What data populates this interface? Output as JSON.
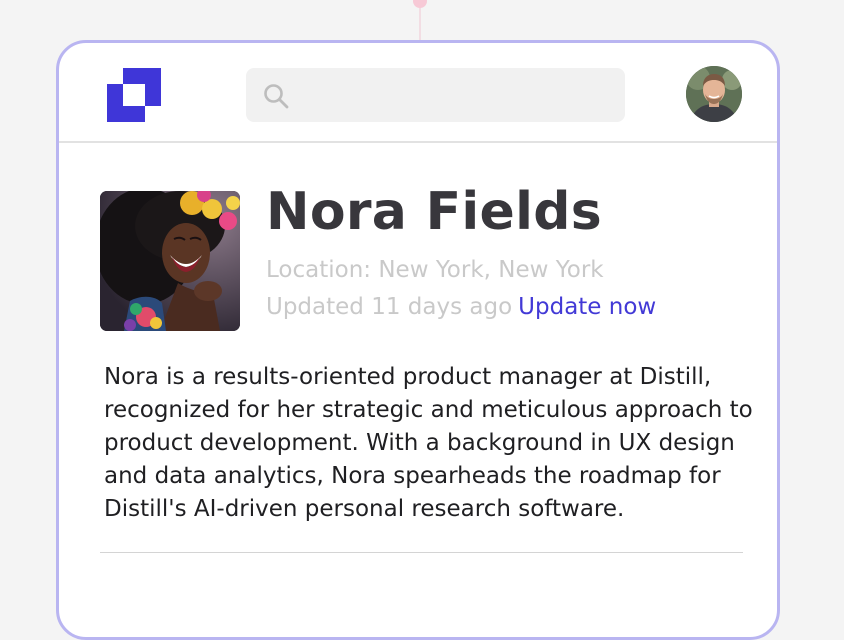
{
  "header": {
    "search": {
      "value": "",
      "placeholder": ""
    }
  },
  "profile": {
    "name": "Nora Fields",
    "location": "Location: New York, New York",
    "updated": "Updated 11 days ago",
    "update_link": "Update now",
    "bio": "Nora is a results-oriented product manager at Distill, recognized for her strategic and meticulous approach to product development. With a background in UX design and data analytics, Nora spearheads the roadmap for Distill's AI-driven personal research software."
  },
  "icons": {
    "logo": "distill-logo-icon",
    "search": "search-icon",
    "avatar": "user-avatar"
  },
  "colors": {
    "accent": "#4239d6",
    "card_border": "#b9b5f1",
    "name": "#38373c",
    "muted": "#c9c9c9",
    "body_text": "#1f1f22"
  }
}
